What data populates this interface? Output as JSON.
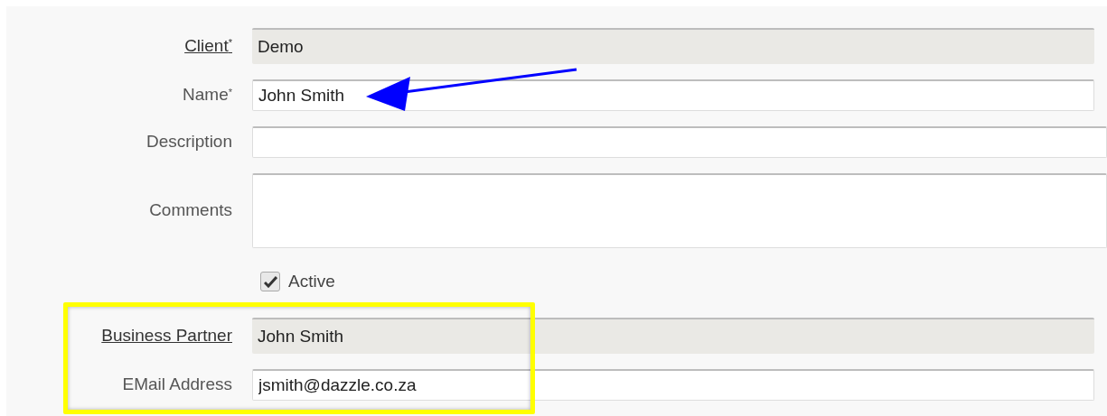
{
  "fields": [
    {
      "kind": "readonly",
      "label": "Client",
      "mark": "*",
      "link": true,
      "value": "Demo",
      "wide": false
    },
    {
      "kind": "input",
      "label": "Name",
      "mark": "*",
      "link": false,
      "value": "John Smith",
      "wide": false
    },
    {
      "kind": "input",
      "label": "Description",
      "link": false,
      "wide": true
    },
    {
      "kind": "textarea",
      "label": "Comments",
      "link": false,
      "wide": true
    },
    {
      "kind": "checkbox",
      "label": "Active",
      "checked": true
    },
    {
      "kind": "readonly",
      "label": "Business Partner",
      "link": true,
      "value": "John Smith",
      "wide": false
    },
    {
      "kind": "input",
      "label": "EMail Address",
      "link": false,
      "value": "jsmith@dazzle.co.za",
      "wide": false
    }
  ],
  "annotations": [
    {
      "kind": "arrow",
      "color": "#0000ff"
    },
    {
      "kind": "highlight",
      "color": "#ffff00"
    }
  ]
}
